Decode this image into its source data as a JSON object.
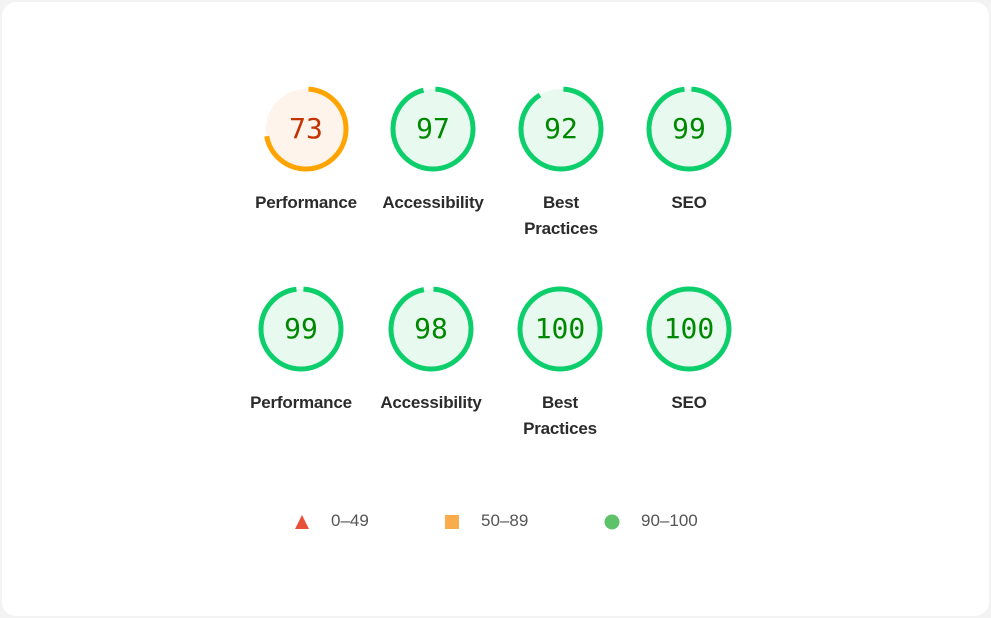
{
  "rows": [
    [
      {
        "label": "Performance",
        "score": 73
      },
      {
        "label": "Accessibility",
        "score": 97
      },
      {
        "label": "Best Practices",
        "score": 92
      },
      {
        "label": "SEO",
        "score": 99
      }
    ],
    [
      {
        "label": "Performance",
        "score": 99
      },
      {
        "label": "Accessibility",
        "score": 98
      },
      {
        "label": "Best Practices",
        "score": 100
      },
      {
        "label": "SEO",
        "score": 100
      }
    ]
  ],
  "legend": [
    {
      "icon": "triangle-icon",
      "label": "0–49",
      "color": "#e8503a"
    },
    {
      "icon": "square-icon",
      "label": "50–89",
      "color": "#faab4b"
    },
    {
      "icon": "circle-icon",
      "label": "90–100",
      "color": "#5ec26a"
    }
  ],
  "colors": {
    "pass": {
      "stroke": "#0cce6b",
      "fill": "#e8faf0",
      "text": "#008800"
    },
    "average": {
      "stroke": "#ffa400",
      "fill": "#fff4eb",
      "text": "#c33300"
    }
  }
}
